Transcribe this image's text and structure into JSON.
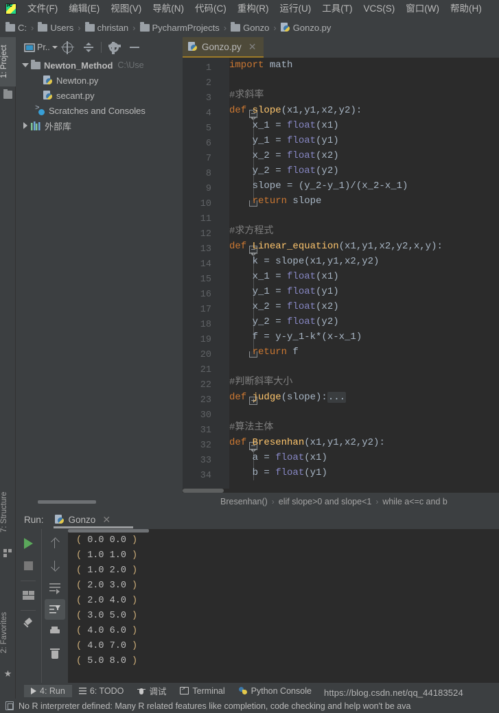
{
  "menu": {
    "logo_icon": "pycharm-logo-icon",
    "items": [
      {
        "text": "文件(F)",
        "mnemonic": "F"
      },
      {
        "text": "编辑(E)",
        "mnemonic": "E"
      },
      {
        "text": "视图(V)",
        "mnemonic": "V"
      },
      {
        "text": "导航(N)",
        "mnemonic": "N"
      },
      {
        "text": "代码(C)",
        "mnemonic": "C"
      },
      {
        "text": "重构(R)",
        "mnemonic": "R"
      },
      {
        "text": "运行(U)",
        "mnemonic": "U"
      },
      {
        "text": "工具(T)",
        "mnemonic": "T"
      },
      {
        "text": "VCS(S)",
        "mnemonic": "S"
      },
      {
        "text": "窗口(W)",
        "mnemonic": "W"
      },
      {
        "text": "帮助(H)",
        "mnemonic": "H"
      }
    ]
  },
  "breadcrumb": {
    "items": [
      {
        "label": "C:",
        "icon": "folder-icon"
      },
      {
        "label": "Users",
        "icon": "folder-icon"
      },
      {
        "label": "christan",
        "icon": "folder-icon"
      },
      {
        "label": "PycharmProjects",
        "icon": "folder-icon"
      },
      {
        "label": "Gonzo",
        "icon": "folder-icon"
      },
      {
        "label": "Gonzo.py",
        "icon": "python-file-icon"
      }
    ],
    "separator": "›"
  },
  "left_strip": {
    "project": {
      "label": "1: Project",
      "icon": "folder-icon"
    },
    "structure": {
      "label": "7: Structure",
      "icon": "structure-icon"
    },
    "favorites": {
      "label": "2: Favorites",
      "icon": "star-icon"
    }
  },
  "project_panel": {
    "toolbar": {
      "view_label": "Pr..",
      "view_icon": "window-icon",
      "locate_icon": "target-icon",
      "collapse_icon": "collapse-all-icon",
      "settings_icon": "gear-icon",
      "hide_icon": "minimize-icon"
    },
    "tree": [
      {
        "label": "Newton_Method",
        "sublabel": "C:\\Use",
        "icon": "folder-icon",
        "twisty": "open",
        "indent": 0,
        "bold": true
      },
      {
        "label": "Newton.py",
        "sublabel": "",
        "icon": "python-file-icon",
        "twisty": "none",
        "indent": 1,
        "bold": false
      },
      {
        "label": "secant.py",
        "sublabel": "",
        "icon": "python-file-icon",
        "twisty": "none",
        "indent": 1,
        "bold": false
      },
      {
        "label": "Scratches and Consoles",
        "sublabel": "",
        "icon": "scratches-icon",
        "twisty": "none",
        "indent": 0,
        "bold": false
      },
      {
        "label": "外部库",
        "sublabel": "",
        "icon": "external-libraries-icon",
        "twisty": "closed",
        "indent": 0,
        "bold": false
      }
    ]
  },
  "editor": {
    "tab": {
      "name": "Gonzo.py",
      "icon": "python-file-icon",
      "close_icon": "close-icon"
    },
    "lines": [
      {
        "num": "1",
        "fold": "none",
        "tokens": [
          {
            "t": "import",
            "c": "k"
          },
          {
            "t": " math",
            "c": "id"
          }
        ]
      },
      {
        "num": "2",
        "fold": "none",
        "tokens": []
      },
      {
        "num": "3",
        "fold": "none",
        "tokens": [
          {
            "t": "#求斜率",
            "c": "cm"
          }
        ]
      },
      {
        "num": "4",
        "fold": "start",
        "tokens": [
          {
            "t": "def ",
            "c": "k"
          },
          {
            "t": "slope",
            "c": "fn"
          },
          {
            "t": "(x1,y1,x2,y2):",
            "c": "id"
          }
        ]
      },
      {
        "num": "5",
        "fold": "none",
        "tokens": [
          {
            "t": "    x_1 = ",
            "c": "id"
          },
          {
            "t": "float",
            "c": "bi"
          },
          {
            "t": "(x1)",
            "c": "id"
          }
        ]
      },
      {
        "num": "6",
        "fold": "none",
        "tokens": [
          {
            "t": "    y_1 = ",
            "c": "id"
          },
          {
            "t": "float",
            "c": "bi"
          },
          {
            "t": "(y1)",
            "c": "id"
          }
        ]
      },
      {
        "num": "7",
        "fold": "none",
        "tokens": [
          {
            "t": "    x_2 = ",
            "c": "id"
          },
          {
            "t": "float",
            "c": "bi"
          },
          {
            "t": "(x2)",
            "c": "id"
          }
        ]
      },
      {
        "num": "8",
        "fold": "none",
        "tokens": [
          {
            "t": "    y_2 = ",
            "c": "id"
          },
          {
            "t": "float",
            "c": "bi"
          },
          {
            "t": "(y2)",
            "c": "id"
          }
        ]
      },
      {
        "num": "9",
        "fold": "none",
        "tokens": [
          {
            "t": "    slope = (y_2-y_1)/(x_2-x_1)",
            "c": "id"
          }
        ]
      },
      {
        "num": "10",
        "fold": "end",
        "tokens": [
          {
            "t": "    ",
            "c": "id"
          },
          {
            "t": "return",
            "c": "k"
          },
          {
            "t": " slope",
            "c": "id"
          }
        ]
      },
      {
        "num": "11",
        "fold": "none",
        "tokens": []
      },
      {
        "num": "12",
        "fold": "none",
        "tokens": [
          {
            "t": "#求方程式",
            "c": "cm"
          }
        ]
      },
      {
        "num": "13",
        "fold": "start",
        "tokens": [
          {
            "t": "def ",
            "c": "k"
          },
          {
            "t": "Linear_equation",
            "c": "fn"
          },
          {
            "t": "(x1,y1,x2,y2,x,y):",
            "c": "id"
          }
        ]
      },
      {
        "num": "14",
        "fold": "none",
        "tokens": [
          {
            "t": "    k = slope(x1,y1,x2,y2)",
            "c": "id"
          }
        ]
      },
      {
        "num": "15",
        "fold": "none",
        "tokens": [
          {
            "t": "    x_1 = ",
            "c": "id"
          },
          {
            "t": "float",
            "c": "bi"
          },
          {
            "t": "(x1)",
            "c": "id"
          }
        ]
      },
      {
        "num": "16",
        "fold": "none",
        "tokens": [
          {
            "t": "    y_1 = ",
            "c": "id"
          },
          {
            "t": "float",
            "c": "bi"
          },
          {
            "t": "(y1)",
            "c": "id"
          }
        ]
      },
      {
        "num": "17",
        "fold": "none",
        "tokens": [
          {
            "t": "    x_2 = ",
            "c": "id"
          },
          {
            "t": "float",
            "c": "bi"
          },
          {
            "t": "(x2)",
            "c": "id"
          }
        ]
      },
      {
        "num": "18",
        "fold": "none",
        "tokens": [
          {
            "t": "    y_2 = ",
            "c": "id"
          },
          {
            "t": "float",
            "c": "bi"
          },
          {
            "t": "(y2)",
            "c": "id"
          }
        ]
      },
      {
        "num": "19",
        "fold": "none",
        "tokens": [
          {
            "t": "    f = y-y_1-k*(x-x_1)",
            "c": "id"
          }
        ]
      },
      {
        "num": "20",
        "fold": "end",
        "tokens": [
          {
            "t": "    ",
            "c": "id"
          },
          {
            "t": "return",
            "c": "k"
          },
          {
            "t": " f",
            "c": "id"
          }
        ]
      },
      {
        "num": "21",
        "fold": "none",
        "tokens": []
      },
      {
        "num": "22",
        "fold": "none",
        "tokens": [
          {
            "t": "#判断斜率大小",
            "c": "cm"
          }
        ]
      },
      {
        "num": "23",
        "fold": "plus",
        "tokens": [
          {
            "t": "def ",
            "c": "k"
          },
          {
            "t": "judge",
            "c": "fn"
          },
          {
            "t": "(slope):",
            "c": "id"
          },
          {
            "t": "...",
            "c": "folded"
          }
        ]
      },
      {
        "num": "30",
        "fold": "none",
        "tokens": []
      },
      {
        "num": "31",
        "fold": "none",
        "tokens": [
          {
            "t": "#算法主体",
            "c": "cm"
          }
        ]
      },
      {
        "num": "32",
        "fold": "start",
        "tokens": [
          {
            "t": "def ",
            "c": "k"
          },
          {
            "t": "Bresenhan",
            "c": "fn"
          },
          {
            "t": "(x1,y1,x2,y2):",
            "c": "id"
          }
        ]
      },
      {
        "num": "33",
        "fold": "none",
        "tokens": [
          {
            "t": "    a = ",
            "c": "id"
          },
          {
            "t": "float",
            "c": "bi"
          },
          {
            "t": "(x1)",
            "c": "id"
          }
        ]
      },
      {
        "num": "34",
        "fold": "none",
        "tokens": [
          {
            "t": "    b = ",
            "c": "id"
          },
          {
            "t": "float",
            "c": "bi"
          },
          {
            "t": "(y1)",
            "c": "id"
          }
        ]
      }
    ],
    "breadcrumbs": [
      "Bresenhan()",
      "elif slope>0 and slope<1",
      "while a<=c and b"
    ],
    "breadcrumb_separator": "›"
  },
  "run_panel": {
    "label": "Run:",
    "tab": {
      "name": "Gonzo",
      "icon": "python-file-icon",
      "close_icon": "close-icon"
    },
    "toolbar_left": [
      {
        "name": "rerun-button",
        "icon": "play-icon"
      },
      {
        "name": "stop-button",
        "icon": "stop-icon"
      },
      {
        "name": "layout-button",
        "icon": "layout-icon"
      },
      {
        "name": "pin-tab-button",
        "icon": "pin-icon"
      }
    ],
    "toolbar_right": [
      {
        "name": "prev-occurrence-button",
        "icon": "arrow-up-icon"
      },
      {
        "name": "next-occurrence-button",
        "icon": "arrow-down-icon"
      },
      {
        "name": "soft-wrap-button",
        "icon": "soft-wrap-icon"
      },
      {
        "name": "scroll-to-end-button",
        "icon": "scroll-to-end-icon"
      },
      {
        "name": "print-button",
        "icon": "print-icon"
      },
      {
        "name": "clear-all-button",
        "icon": "trash-icon"
      }
    ],
    "console_output": [
      "( 0.0 0.0 )",
      "( 1.0 1.0 )",
      "( 1.0 2.0 )",
      "( 2.0 3.0 )",
      "( 2.0 4.0 )",
      "( 3.0 5.0 )",
      "( 4.0 6.0 )",
      "( 4.0 7.0 )",
      "( 5.0 8.0 )"
    ]
  },
  "bottom_bar": {
    "items": [
      {
        "label": "4: Run",
        "mnemonic": "4",
        "icon": "run-icon",
        "active": true
      },
      {
        "label": "6: TODO",
        "mnemonic": "6",
        "icon": "todo-icon",
        "active": false
      },
      {
        "label": "调试",
        "mnemonic": "",
        "icon": "debug-icon",
        "active": false
      },
      {
        "label": "Terminal",
        "mnemonic": "",
        "icon": "terminal-icon",
        "active": false
      },
      {
        "label": "Python Console",
        "mnemonic": "",
        "icon": "python-console-icon",
        "active": false
      }
    ]
  },
  "status_bar": {
    "icon": "note-icon",
    "message": "No R interpreter defined: Many R related features like completion, code checking and help won't be ava"
  },
  "watermark": "https://blog.csdn.net/qq_44183524",
  "colors": {
    "accent_keyword": "#CC7832",
    "accent_function": "#FFC66D",
    "accent_builtin": "#8888C6",
    "comment": "#808080",
    "default_text": "#A9B7C6",
    "editor_bg": "#2B2B2B",
    "panel_bg": "#3C3F41",
    "tab_active_bg": "#4E4A39",
    "run_green": "#5BA85B"
  }
}
